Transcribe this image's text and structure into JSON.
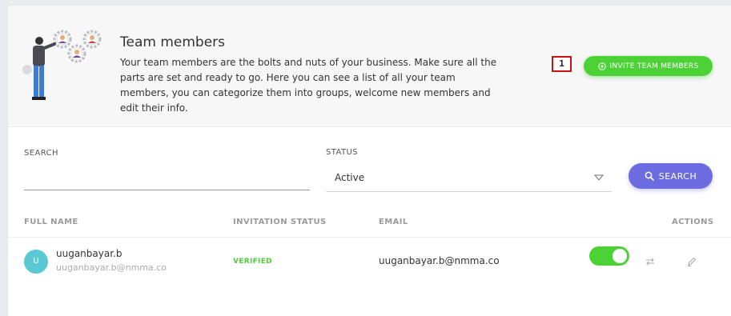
{
  "banner": {
    "title": "Team members",
    "description": "Your team members are the bolts and nuts of your business. Make sure all the parts are set and ready to go. Here you can see a list of all your team members, you can categorize them into groups, welcome new members and edit their info.",
    "step_badge": "1",
    "invite_label": "INVITE TEAM MEMBERS",
    "invite_icon": "plus-circle-icon"
  },
  "filters": {
    "search_label": "SEARCH",
    "search_value": "",
    "status_label": "STATUS",
    "status_value": "Active",
    "search_button": "SEARCH",
    "search_icon": "magnifier-icon"
  },
  "table": {
    "columns": [
      "FULL NAME",
      "INVITATION STATUS",
      "EMAIL",
      "ACTIONS"
    ],
    "rows": [
      {
        "initial": "U",
        "name": "uuganbayar.b",
        "username": "uuganbayar.b@nmma.co",
        "invitation_status": "VERIFIED",
        "email": "uuganbayar.b@nmma.co",
        "active": true
      }
    ]
  },
  "colors": {
    "accent_green": "#4cd137",
    "accent_purple": "#6c6ce0",
    "avatar": "#5bc8d6",
    "badge_border": "#cc1111"
  }
}
